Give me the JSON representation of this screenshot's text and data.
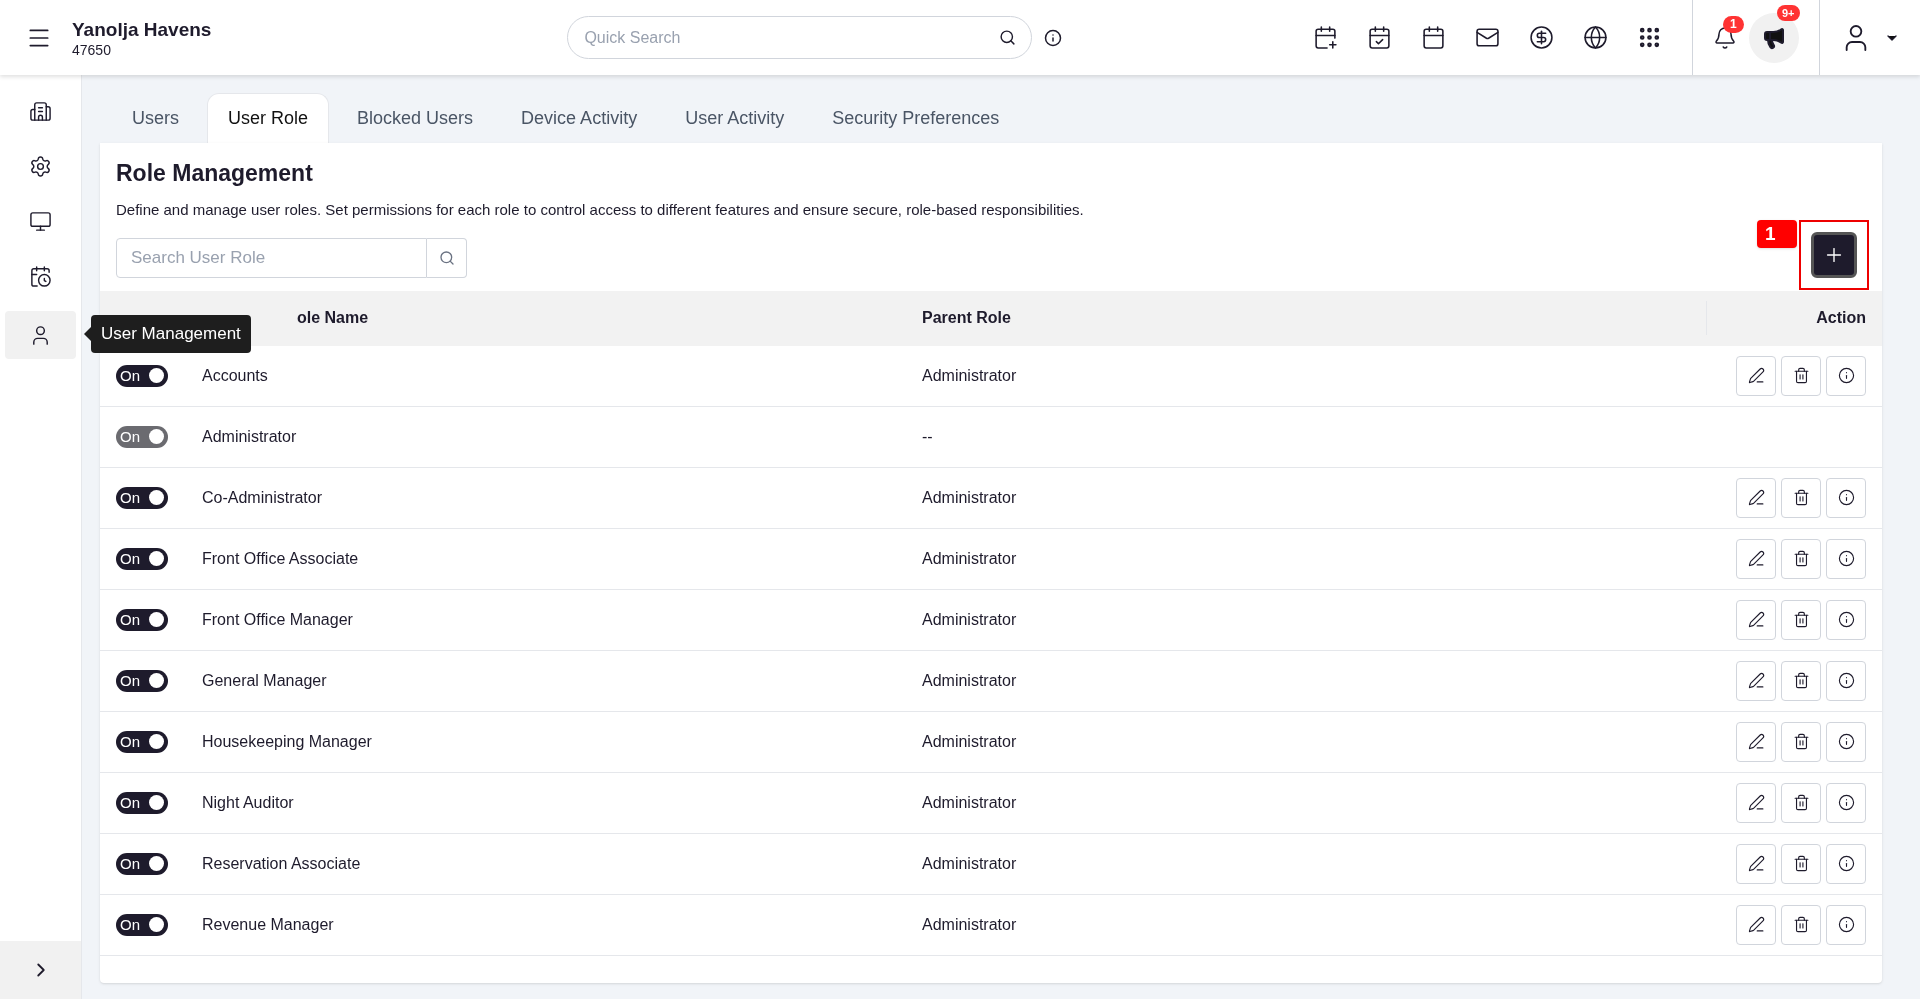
{
  "header": {
    "property_name": "Yanolja Havens",
    "property_id": "47650",
    "search": {
      "placeholder": "Quick Search"
    },
    "notifications": {
      "count": "1"
    },
    "announcements": {
      "count": "9+"
    }
  },
  "sidebar": {
    "items": [
      {
        "selected": false
      },
      {
        "selected": false
      },
      {
        "selected": false
      },
      {
        "selected": false
      },
      {
        "selected": true
      }
    ],
    "tooltip": "User Management"
  },
  "tabs": [
    {
      "label": "Users",
      "selected": false
    },
    {
      "label": "User Role",
      "selected": true
    },
    {
      "label": "Blocked Users",
      "selected": false
    },
    {
      "label": "Device Activity",
      "selected": false
    },
    {
      "label": "User Activity",
      "selected": false
    },
    {
      "label": "Security Preferences",
      "selected": false
    }
  ],
  "panel": {
    "title": "Role Management",
    "description": "Define and manage user roles. Set permissions for each role to control access to different features and ensure secure, role-based responsibilities.",
    "search": {
      "placeholder": "Search User Role"
    },
    "callout": "1"
  },
  "table": {
    "columns": [
      "ole Name",
      "Parent Role",
      "Action"
    ],
    "rows": [
      {
        "toggle": "On",
        "on": true,
        "disabled": false,
        "name": "Accounts",
        "parent": "Administrator",
        "actions": true
      },
      {
        "toggle": "On",
        "on": true,
        "disabled": true,
        "name": "Administrator",
        "parent": "--",
        "actions": false
      },
      {
        "toggle": "On",
        "on": true,
        "disabled": false,
        "name": "Co-Administrator",
        "parent": "Administrator",
        "actions": true
      },
      {
        "toggle": "On",
        "on": true,
        "disabled": false,
        "name": "Front Office Associate",
        "parent": "Administrator",
        "actions": true
      },
      {
        "toggle": "On",
        "on": true,
        "disabled": false,
        "name": "Front Office Manager",
        "parent": "Administrator",
        "actions": true
      },
      {
        "toggle": "On",
        "on": true,
        "disabled": false,
        "name": "General Manager",
        "parent": "Administrator",
        "actions": true
      },
      {
        "toggle": "On",
        "on": true,
        "disabled": false,
        "name": "Housekeeping Manager",
        "parent": "Administrator",
        "actions": true
      },
      {
        "toggle": "On",
        "on": true,
        "disabled": false,
        "name": "Night Auditor",
        "parent": "Administrator",
        "actions": true
      },
      {
        "toggle": "On",
        "on": true,
        "disabled": false,
        "name": "Reservation Associate",
        "parent": "Administrator",
        "actions": true
      },
      {
        "toggle": "On",
        "on": true,
        "disabled": false,
        "name": "Revenue Manager",
        "parent": "Administrator",
        "actions": true
      }
    ]
  }
}
